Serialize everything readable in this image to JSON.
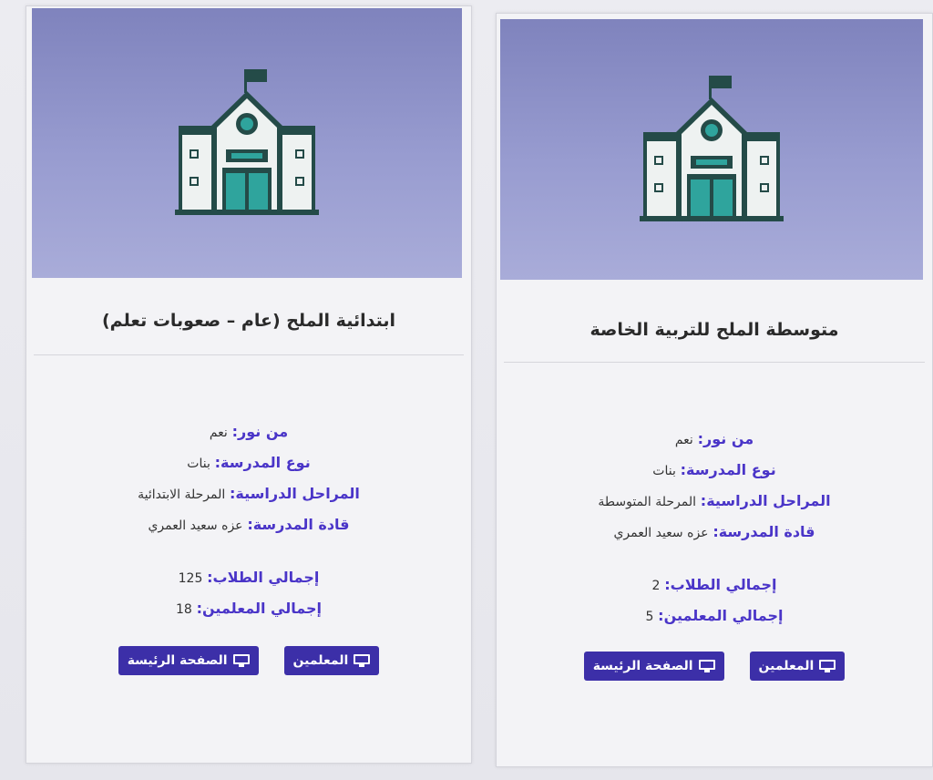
{
  "cards": [
    {
      "title": "ابتدائية الملح (عام – صعوبات تعلم)",
      "fields": [
        {
          "label": "من نور:",
          "value": "نعم"
        },
        {
          "label": "نوع المدرسة:",
          "value": "بنات"
        },
        {
          "label": "المراحل الدراسية:",
          "value": "المرحلة الابتدائية"
        },
        {
          "label": "قادة المدرسة:",
          "value": "عزه سعيد العمري"
        }
      ],
      "totals": [
        {
          "label": "إجمالي الطلاب:",
          "value": "125"
        },
        {
          "label": "إجمالي المعلمين:",
          "value": "18"
        }
      ],
      "buttons": {
        "teachers": "المعلمين",
        "home": "الصفحة الرئيسة"
      }
    },
    {
      "title": "متوسطة الملح للتربية الخاصة",
      "fields": [
        {
          "label": "من نور:",
          "value": "نعم"
        },
        {
          "label": "نوع المدرسة:",
          "value": "بنات"
        },
        {
          "label": "المراحل الدراسية:",
          "value": "المرحلة المتوسطة"
        },
        {
          "label": "قادة المدرسة:",
          "value": "عزه سعيد العمري"
        }
      ],
      "totals": [
        {
          "label": "إجمالي الطلاب:",
          "value": "2"
        },
        {
          "label": "إجمالي المعلمين:",
          "value": "5"
        }
      ],
      "buttons": {
        "teachers": "المعلمين",
        "home": "الصفحة الرئيسة"
      }
    }
  ],
  "icons": {
    "hero": "school-icon",
    "button": "monitor-icon"
  },
  "colors": {
    "accent": "#3c2fa8",
    "label": "#4a35c8",
    "hero": "#8f93c8"
  }
}
